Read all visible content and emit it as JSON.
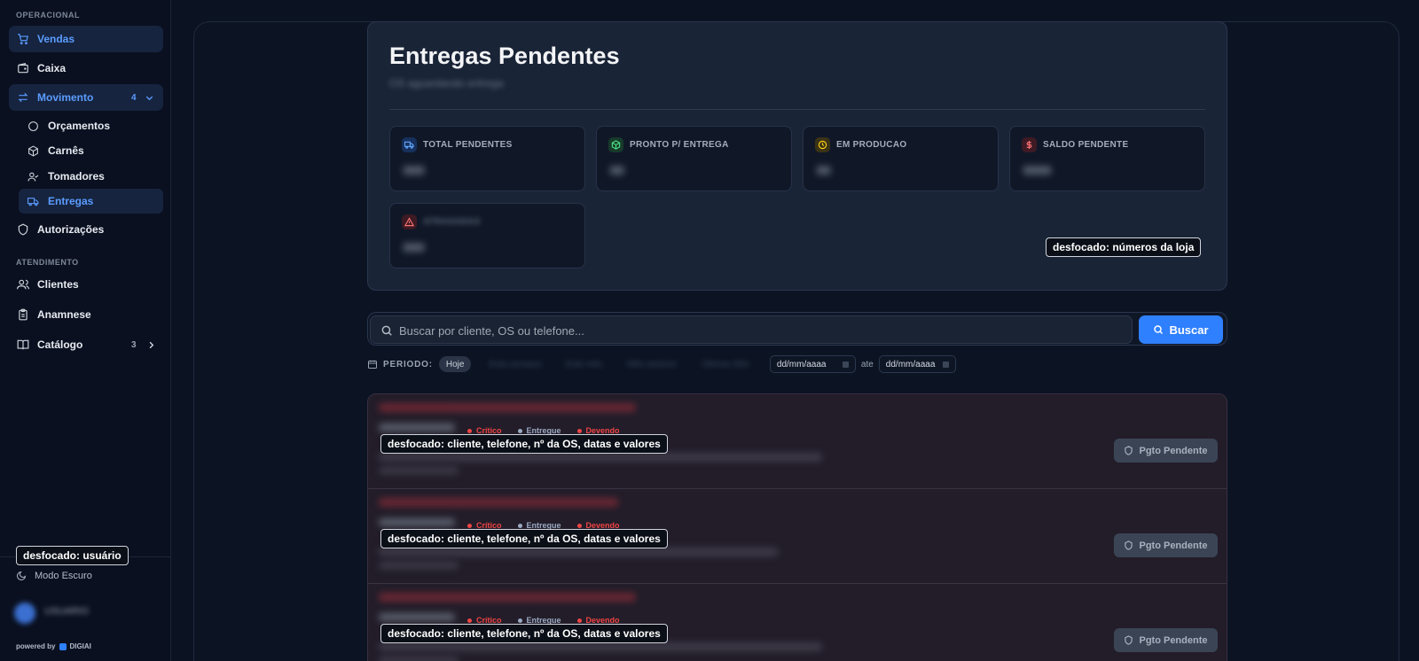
{
  "sidebar": {
    "section_operacional": "OPERACIONAL",
    "section_atendimento": "ATENDIMENTO",
    "vendas": "Vendas",
    "caixa": "Caixa",
    "movimento": "Movimento",
    "movimento_count": "4",
    "orcamentos": "Orçamentos",
    "carnes": "Carnês",
    "tomadores": "Tomadores",
    "entregas": "Entregas",
    "autorizacoes": "Autorizações",
    "clientes": "Clientes",
    "anamnese": "Anamnese",
    "catalogo": "Catálogo",
    "catalogo_count": "3",
    "user_tag": "desfocado: usuário",
    "dark_mode": "Modo Escuro",
    "user_name": "USUARIO",
    "powered_by": "powered by",
    "brand": "DIGIAI"
  },
  "header": {
    "title": "Entregas Pendentes",
    "subtitle": "OS aguardando entrega",
    "store_tag": "desfocado: números da loja"
  },
  "cards": [
    {
      "label": "TOTAL PENDENTES",
      "value": "000",
      "icon": "truck-icon",
      "color": "#3b82f6"
    },
    {
      "label": "PRONTO P/ ENTREGA",
      "value": "00",
      "icon": "package-icon",
      "color": "#22c55e"
    },
    {
      "label": "EM PRODUCAO",
      "value": "00",
      "icon": "clock-icon",
      "color": "#eab308"
    },
    {
      "label": "SALDO PENDENTE",
      "value": "0000",
      "icon": "dollar-icon",
      "color": "#ef4444"
    },
    {
      "label": "ATRASADAS",
      "value": "000",
      "icon": "alert-icon",
      "color": "#ef4444"
    }
  ],
  "search": {
    "placeholder": "Buscar por cliente, OS ou telefone...",
    "button": "Buscar"
  },
  "period": {
    "label": "PERIODO:",
    "today": "Hoje",
    "chips": [
      "Esta semana",
      "Este mês",
      "Mês anterior",
      "Últimos 90d"
    ],
    "date_from": "dd/mm/aaaa",
    "ate": "ate",
    "date_to": "dd/mm/aaaa"
  },
  "rows": [
    {
      "badge_critico": "Crítico",
      "badge_entregue": "Entregue",
      "badge_devendo": "Devendo",
      "tag": "desfocado: cliente, telefone, nº da OS, datas e valores",
      "action": "Pgto Pendente"
    },
    {
      "badge_critico": "Crítico",
      "badge_entregue": "Entregue",
      "badge_devendo": "Devendo",
      "tag": "desfocado: cliente, telefone, nº da OS, datas e valores",
      "action": "Pgto Pendente"
    },
    {
      "badge_critico": "Crítico",
      "badge_entregue": "Entregue",
      "badge_devendo": "Devendo",
      "tag": "desfocado: cliente, telefone, nº da OS, datas e valores",
      "action": "Pgto Pendente"
    }
  ],
  "colors": {
    "accent": "#2f80ff",
    "critico": "#ef4444",
    "entregue": "#9aa9c2",
    "devendo": "#ef4444"
  }
}
